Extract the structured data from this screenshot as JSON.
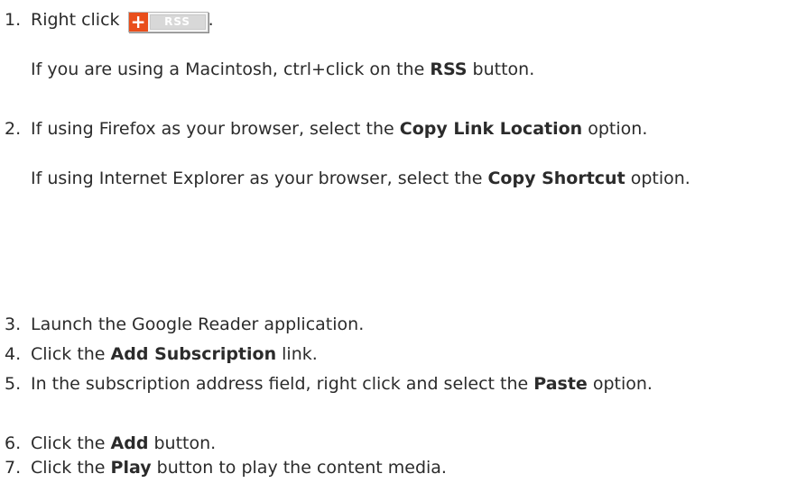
{
  "rss_button": {
    "plus": "+",
    "label": "RSS"
  },
  "steps": [
    {
      "number": "1.",
      "line1_before": "Right click",
      "line1_after": ".",
      "note_before": "If you are using a Macintosh, ctrl+click on the ",
      "note_bold": "RSS",
      "note_after": " button."
    },
    {
      "number": "2.",
      "p1_before": "If using Firefox as your browser, select the ",
      "p1_bold": "Copy Link Location",
      "p1_after": " option.",
      "p2_before": "If using Internet Explorer as your browser, select the ",
      "p2_bold": "Copy Shortcut",
      "p2_after": " option."
    },
    {
      "number": "3.",
      "text": "Launch the Google Reader application."
    },
    {
      "number": "4.",
      "before": "Click the ",
      "bold": "Add Subscription",
      "after": " link."
    },
    {
      "number": "5.",
      "before": "In the subscription address field, right click and select the ",
      "bold": "Paste",
      "after": " option."
    },
    {
      "number": "6.",
      "before": "Click the ",
      "bold": "Add",
      "after": " button."
    },
    {
      "number": "7.",
      "before": "Click the ",
      "bold": "Play",
      "after": " button to play the content media."
    }
  ]
}
